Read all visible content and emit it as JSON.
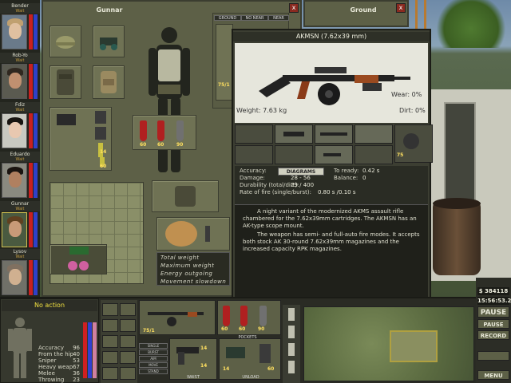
{
  "mercs": [
    {
      "name": "Bender",
      "status": "Wait",
      "skin": "#e0c0a0",
      "hair": "#c0a070"
    },
    {
      "name": "Rob-Yo",
      "status": "Wait",
      "skin": "#c09070",
      "hair": "#302820"
    },
    {
      "name": "Fdiz",
      "status": "Wait",
      "skin": "#e8c8b0",
      "hair": "#181410"
    },
    {
      "name": "Eduardo",
      "status": "Wait",
      "skin": "#b08060",
      "hair": "#1a1410"
    },
    {
      "name": "Gunnar",
      "status": "Wait",
      "skin": "#c89a78",
      "hair": "#604020"
    },
    {
      "name": "Lysov",
      "status": "Wait",
      "skin": "#d0b090",
      "hair": "#807060"
    }
  ],
  "inventory": {
    "title": "Gunnar",
    "weapon_ammo": "75/1",
    "mag_counts": [
      "60",
      "60",
      "90"
    ],
    "small_counts": [
      "14",
      "60"
    ],
    "weight_labels": [
      "Total weight",
      "Maximum weight",
      "Energy outgoing",
      "Movement slowdown"
    ]
  },
  "sector_tabs": [
    "GROUND",
    "NO NEAR",
    "NEAR"
  ],
  "ground": {
    "title": "Ground",
    "close": "x"
  },
  "weapon": {
    "title": "AKMSN (7.62x39 mm)",
    "weight": "Weight: 7.63 kg",
    "wear": "Wear: 0%",
    "dirt": "Dirt: 0%",
    "attach_count": "75",
    "diagrams_label": "DIAGRAMS",
    "stats": {
      "accuracy_label": "Accuracy:",
      "accuracy": "51",
      "damage_label": "Damage:",
      "damage": "28 - 56",
      "durability_label": "Durability (total/dirt):",
      "durability": "29 / 400",
      "rof_label": "Rate of fire (single/burst):",
      "rof": "0.80 s /0.10 s",
      "ready_label": "To ready:",
      "ready": "0.42 s",
      "balance_label": "Balance:",
      "balance": "0"
    },
    "description_p1": "A night variant of the modernized AKMS assault rifle chambered for the 7.62x39mm cartridges. The AKMSN has an AK-type scope mount.",
    "description_p2": "The weapon has semi- and full-auto fire modes. It accepts both stock AK 30-round 7.62x39mm magazines and the increased capacity RPK magazines."
  },
  "hud": {
    "action": "No action",
    "skills": [
      {
        "label": "Accuracy",
        "value": "96"
      },
      {
        "label": "From the hip",
        "value": "40"
      },
      {
        "label": "Sniper",
        "value": "53"
      },
      {
        "label": "Heavy weap",
        "value": "67"
      },
      {
        "label": "Melee",
        "value": "36"
      },
      {
        "label": "Throwing",
        "value": "23"
      }
    ],
    "hand_ammo": "75/1",
    "pocket_counts": [
      "60",
      "60",
      "90"
    ],
    "pockets_label": "POCKETS",
    "waist_label": "WAIST",
    "unload_label": "UNLOAD",
    "waist_counts": [
      "14",
      "14"
    ],
    "unload_counts": [
      "14",
      "60"
    ],
    "side_buttons": [
      "SINGLE",
      "BURST",
      "AIM",
      "MOVE",
      "STAND"
    ],
    "money": "$ 384118",
    "time": "15:56:53.2",
    "pause_big": "PAUSE",
    "pause": "PAUSE",
    "record": "RECORD",
    "menu": "MENU"
  },
  "colors": {
    "panel": "#5d6047",
    "accent": "#f0e040",
    "mag": "#b02020"
  }
}
